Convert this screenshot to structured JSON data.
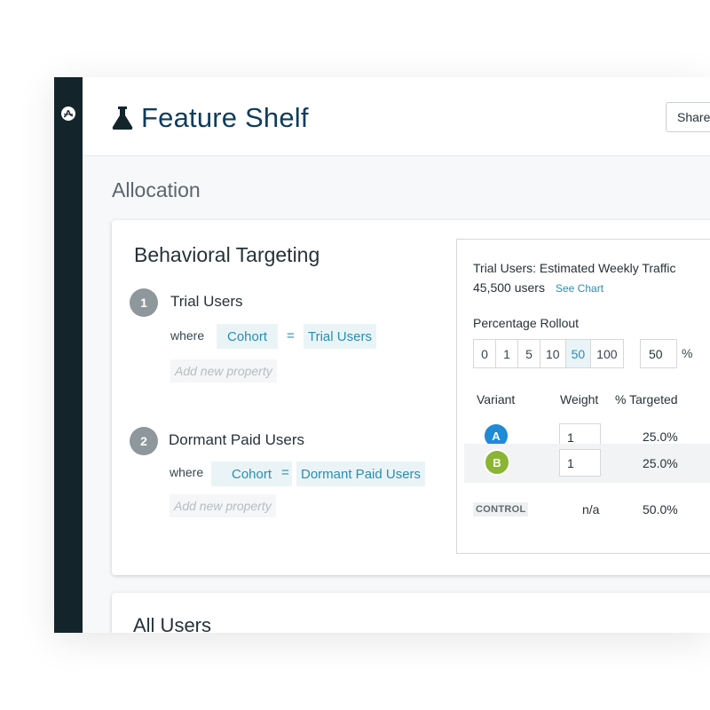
{
  "app": {
    "title": "Feature Shelf",
    "share_label": "Share"
  },
  "allocation": {
    "heading": "Allocation"
  },
  "targeting": {
    "title": "Behavioral Targeting",
    "segments": [
      {
        "number": "1",
        "name": "Trial Users",
        "where": "where",
        "property": "Cohort",
        "operator": "=",
        "value": "Trial Users",
        "add_property": "Add new property"
      },
      {
        "number": "2",
        "name": "Dormant Paid Users",
        "where": "where",
        "property": "Cohort",
        "operator": "=",
        "value": "Dormant Paid Users",
        "add_property": "Add new property"
      }
    ]
  },
  "traffic": {
    "title": "Trial Users: Estimated Weekly Traffic",
    "count": "45,500 users",
    "see_chart": "See Chart"
  },
  "rollout": {
    "label": "Percentage Rollout",
    "options": [
      "0",
      "1",
      "5",
      "10",
      "50",
      "100"
    ],
    "selected": "50",
    "custom_value": "50",
    "unit": "%"
  },
  "variants_table": {
    "headers": {
      "variant": "Variant",
      "weight": "Weight",
      "targeted": "% Targeted"
    },
    "rows": [
      {
        "badge": "A",
        "color": "#1f8ad6",
        "weight": "1",
        "targeted": "25.0%"
      },
      {
        "badge": "B",
        "color": "#8ab534",
        "weight": "1",
        "targeted": "25.0%"
      }
    ],
    "control": {
      "label": "CONTROL",
      "weight": "n/a",
      "targeted": "50.0%"
    }
  },
  "all_users": {
    "title": "All Users"
  }
}
